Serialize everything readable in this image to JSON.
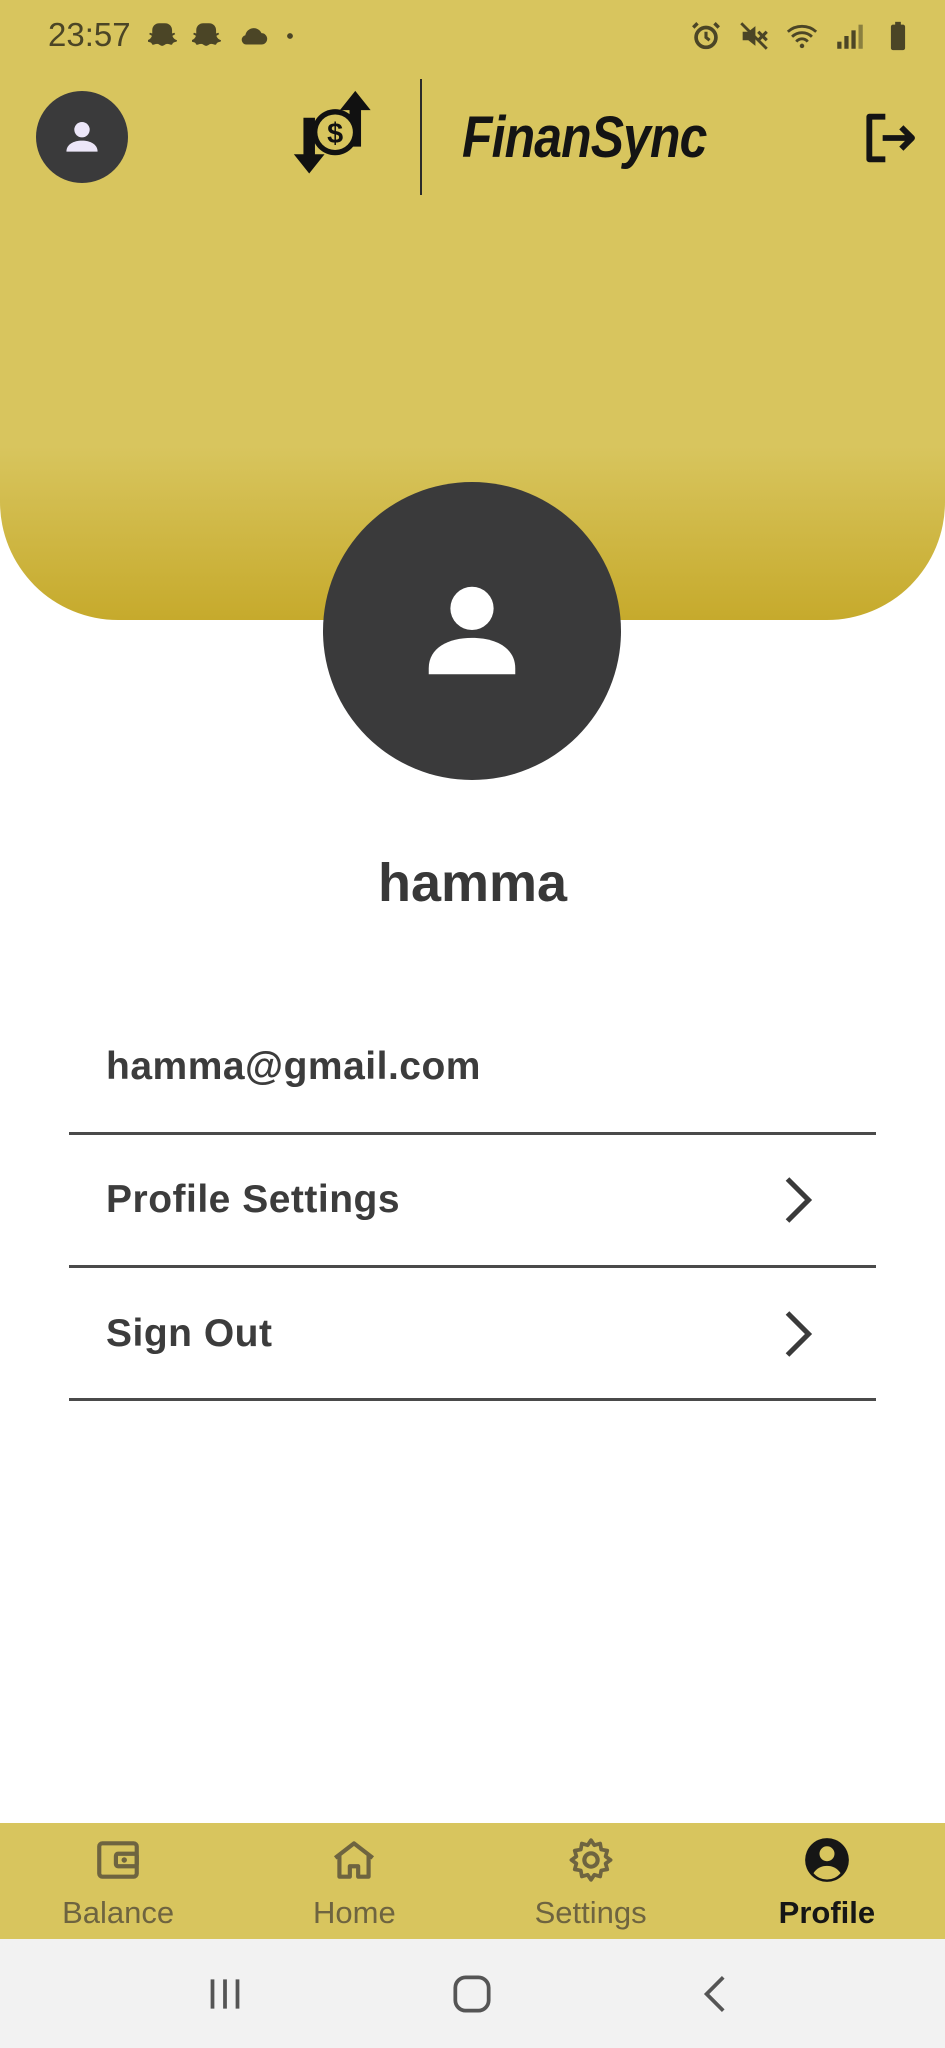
{
  "status_bar": {
    "time": "23:57",
    "left_icons": [
      "snapchat-icon",
      "snapchat-icon",
      "cloud-icon",
      "dot-icon"
    ],
    "right_icons": [
      "alarm-icon",
      "mute-icon",
      "wifi-icon",
      "signal-icon",
      "battery-icon"
    ]
  },
  "header": {
    "app_name": "FinanSync",
    "logo_icon": "money-transfer-icon",
    "profile_icon": "person-icon",
    "logout_icon": "logout-icon",
    "background_color": "#d8c55e"
  },
  "profile": {
    "username": "hamma",
    "email": "hamma@gmail.com"
  },
  "menu": {
    "profile_settings_label": "Profile Settings",
    "sign_out_label": "Sign Out"
  },
  "bottom_nav": {
    "items": [
      {
        "label": "Balance",
        "icon": "wallet-icon",
        "active": false
      },
      {
        "label": "Home",
        "icon": "home-icon",
        "active": false
      },
      {
        "label": "Settings",
        "icon": "gear-icon",
        "active": false
      },
      {
        "label": "Profile",
        "icon": "account-circle-icon",
        "active": true
      }
    ]
  },
  "system_nav": {
    "buttons": [
      "recents-icon",
      "home-circle-icon",
      "back-icon"
    ]
  }
}
